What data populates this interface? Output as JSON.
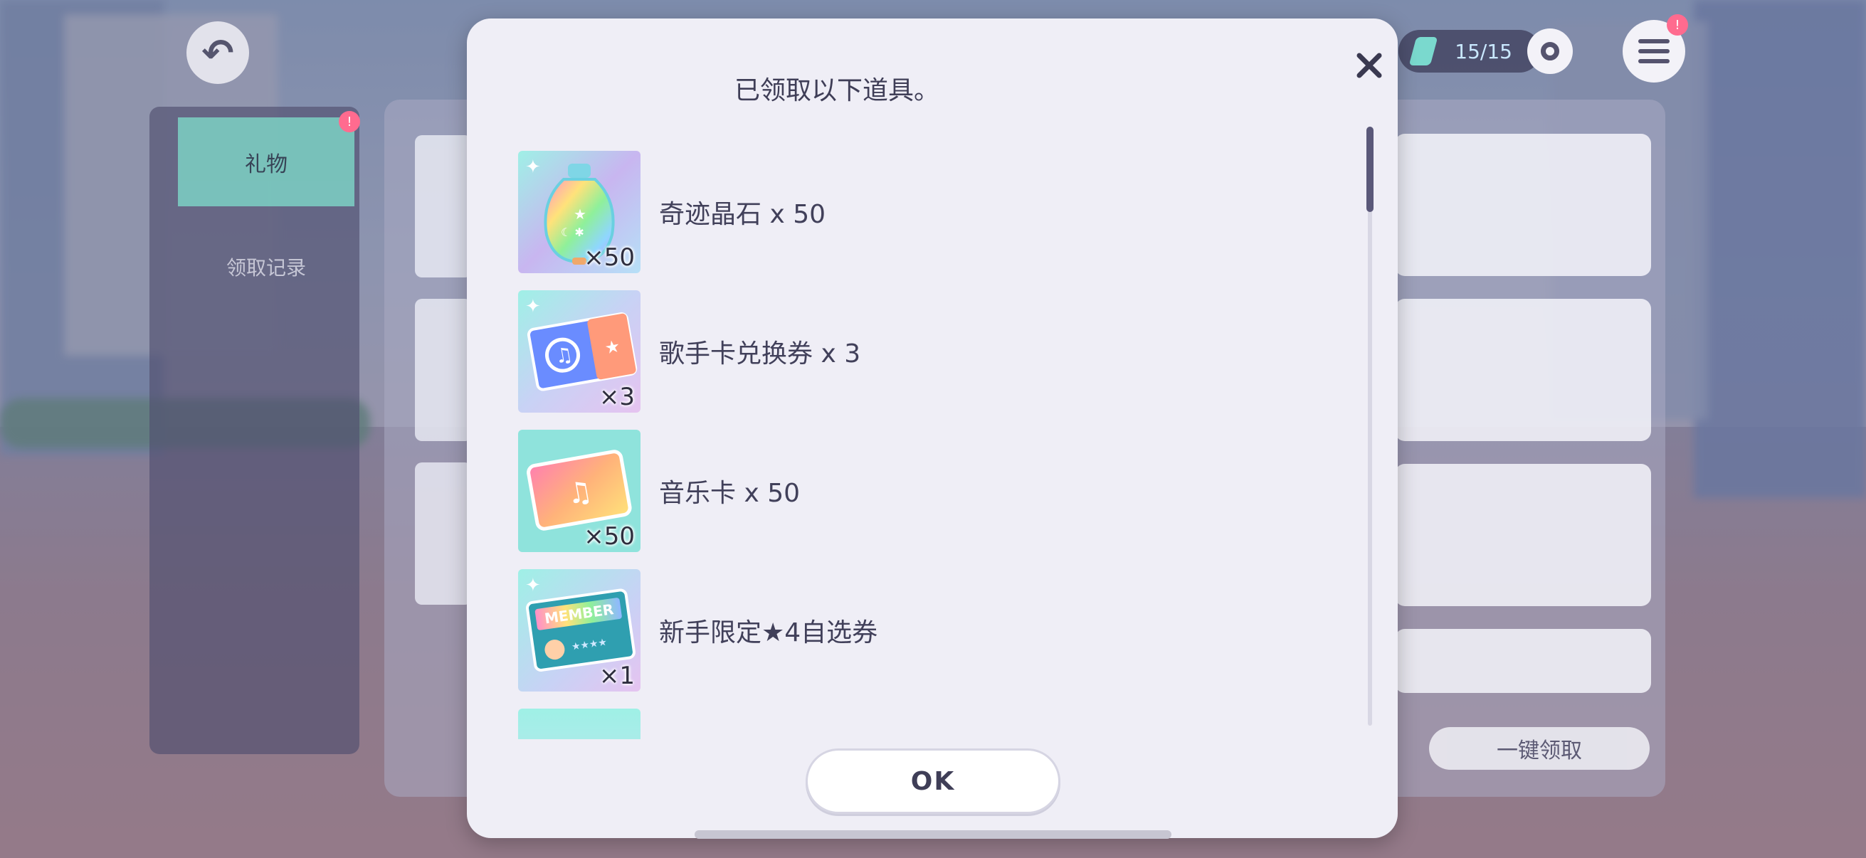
{
  "modal": {
    "title": "已领取以下道具。",
    "ok_label": "OK",
    "items": [
      {
        "name": "奇迹晶石 x 50",
        "qty": "×50",
        "icon": "miracle-crystal-icon"
      },
      {
        "name": "歌手卡兑换券 x 3",
        "qty": "×3",
        "icon": "singer-card-ticket-icon"
      },
      {
        "name": "音乐卡 x 50",
        "qty": "×50",
        "icon": "music-card-icon"
      },
      {
        "name": "新手限定★4自选券",
        "qty": "×1",
        "icon": "member-ticket-icon",
        "icon_text": "MEMBER"
      }
    ]
  },
  "background": {
    "tab_gift": "礼物",
    "tab_record": "领取记录",
    "claim_all": "一键领取",
    "stamina": "15/15",
    "badge": "!"
  },
  "colors": {
    "modal_bg": "#efeef6",
    "text": "#41405a",
    "accent_teal": "#7ed8c8",
    "badge_pink": "#ff6b8f"
  }
}
